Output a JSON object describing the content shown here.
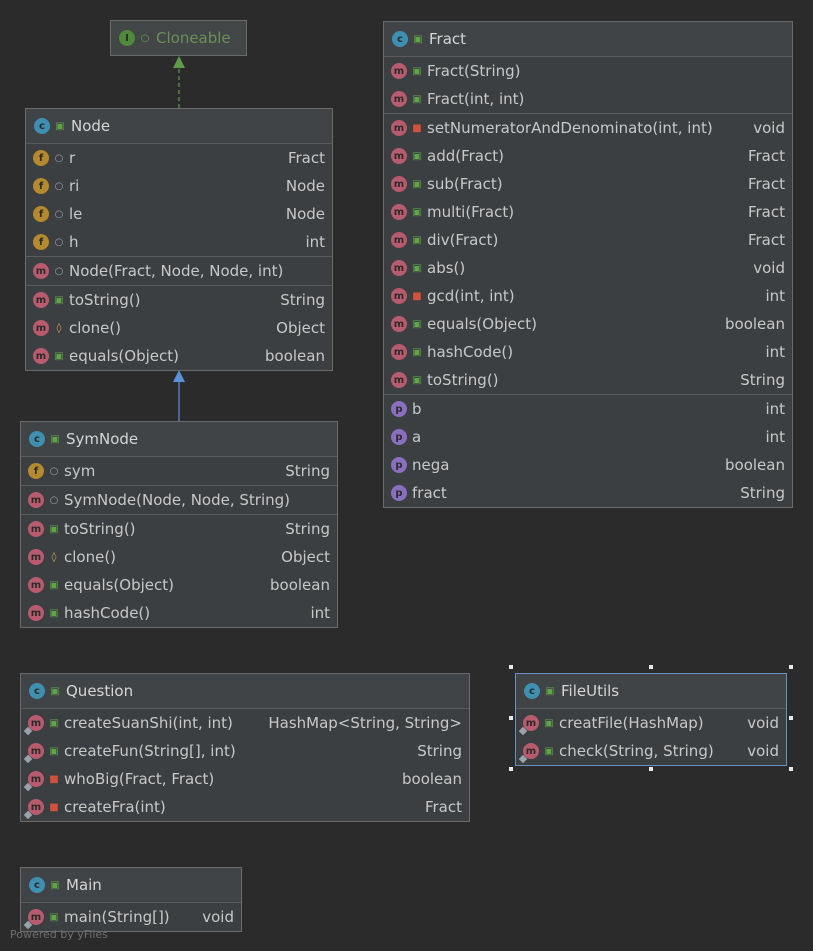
{
  "diagram": {
    "footer": "Powered by yFiles",
    "classes": {
      "cloneable": {
        "kind": "interface",
        "name": "Cloneable"
      },
      "node": {
        "kind": "class",
        "name": "Node",
        "fields": [
          {
            "name": "r",
            "type": "Fract",
            "vis": "package"
          },
          {
            "name": "ri",
            "type": "Node",
            "vis": "package"
          },
          {
            "name": "le",
            "type": "Node",
            "vis": "package"
          },
          {
            "name": "h",
            "type": "int",
            "vis": "package"
          }
        ],
        "constructors": [
          {
            "name": "Node(Fract, Node, Node, int)",
            "type": "",
            "vis": "package"
          }
        ],
        "methods": [
          {
            "name": "toString()",
            "type": "String",
            "vis": "public"
          },
          {
            "name": "clone()",
            "type": "Object",
            "vis": "protected"
          },
          {
            "name": "equals(Object)",
            "type": "boolean",
            "vis": "public"
          }
        ]
      },
      "symnode": {
        "kind": "class",
        "name": "SymNode",
        "fields": [
          {
            "name": "sym",
            "type": "String",
            "vis": "package"
          }
        ],
        "constructors": [
          {
            "name": "SymNode(Node, Node, String)",
            "type": "",
            "vis": "package"
          }
        ],
        "methods": [
          {
            "name": "toString()",
            "type": "String",
            "vis": "public"
          },
          {
            "name": "clone()",
            "type": "Object",
            "vis": "protected"
          },
          {
            "name": "equals(Object)",
            "type": "boolean",
            "vis": "public"
          },
          {
            "name": "hashCode()",
            "type": "int",
            "vis": "public"
          }
        ]
      },
      "fract": {
        "kind": "class",
        "name": "Fract",
        "constructors": [
          {
            "name": "Fract(String)",
            "type": "",
            "vis": "public"
          },
          {
            "name": "Fract(int, int)",
            "type": "",
            "vis": "public"
          }
        ],
        "methods": [
          {
            "name": "setNumeratorAndDenominato(int, int)",
            "type": "void",
            "vis": "private"
          },
          {
            "name": "add(Fract)",
            "type": "Fract",
            "vis": "public"
          },
          {
            "name": "sub(Fract)",
            "type": "Fract",
            "vis": "public"
          },
          {
            "name": "multi(Fract)",
            "type": "Fract",
            "vis": "public"
          },
          {
            "name": "div(Fract)",
            "type": "Fract",
            "vis": "public"
          },
          {
            "name": "abs()",
            "type": "void",
            "vis": "public"
          },
          {
            "name": "gcd(int, int)",
            "type": "int",
            "vis": "private"
          },
          {
            "name": "equals(Object)",
            "type": "boolean",
            "vis": "public"
          },
          {
            "name": "hashCode()",
            "type": "int",
            "vis": "public"
          },
          {
            "name": "toString()",
            "type": "String",
            "vis": "public"
          }
        ],
        "properties": [
          {
            "name": "b",
            "type": "int"
          },
          {
            "name": "a",
            "type": "int"
          },
          {
            "name": "nega",
            "type": "boolean"
          },
          {
            "name": "fract",
            "type": "String"
          }
        ]
      },
      "question": {
        "kind": "class",
        "name": "Question",
        "methods": [
          {
            "name": "createSuanShi(int, int)",
            "type": "HashMap<String, String>",
            "vis": "public"
          },
          {
            "name": "createFun(String[], int)",
            "type": "String",
            "vis": "public"
          },
          {
            "name": "whoBig(Fract, Fract)",
            "type": "boolean",
            "vis": "private"
          },
          {
            "name": "createFra(int)",
            "type": "Fract",
            "vis": "private"
          }
        ]
      },
      "fileutils": {
        "kind": "class",
        "name": "FileUtils",
        "methods": [
          {
            "name": "creatFile(HashMap)",
            "type": "void",
            "vis": "public"
          },
          {
            "name": "check(String, String)",
            "type": "void",
            "vis": "public"
          }
        ]
      },
      "main": {
        "kind": "class",
        "name": "Main",
        "methods": [
          {
            "name": "main(String[])",
            "type": "void",
            "vis": "public"
          }
        ]
      }
    },
    "colors": {
      "implements_edge": "#5e9a4a",
      "extends_edge": "#5b8fd6"
    }
  }
}
